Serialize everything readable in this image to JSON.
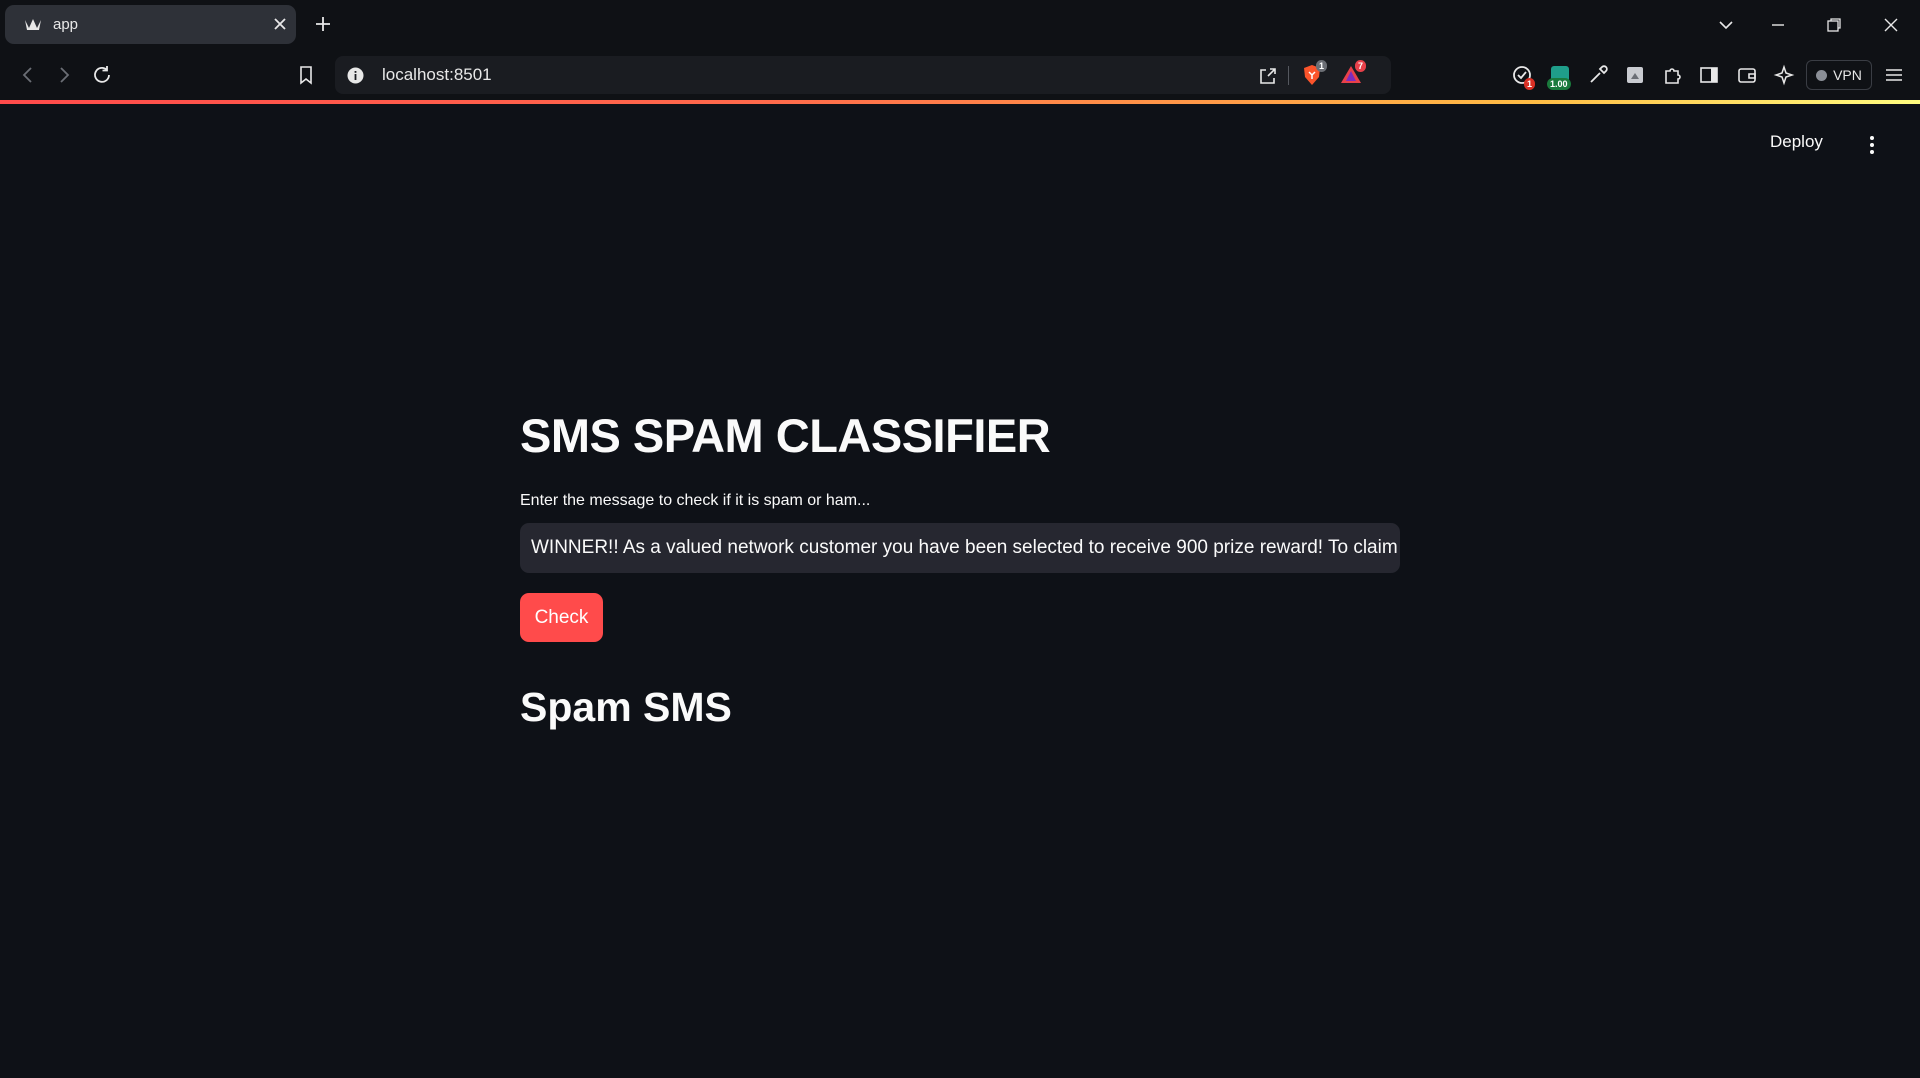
{
  "browser": {
    "tab_title": "app",
    "url": "localhost:8501",
    "brave_badge": "1",
    "rewards_badge": "7",
    "ext_badge_red": "1",
    "ext_badge_green": "1.00",
    "vpn_label": "VPN"
  },
  "app": {
    "deploy_label": "Deploy",
    "title": "SMS SPAM CLASSIFIER",
    "input_label": "Enter the message to check if it is spam or ham...",
    "input_value": "WINNER!! As a valued network customer you have been selected to receive 900 prize reward! To claim call",
    "button_label": "Check",
    "result": "Spam SMS"
  },
  "colors": {
    "background": "#0e1117",
    "primary": "#ff4b4b",
    "input_bg": "#262730"
  }
}
